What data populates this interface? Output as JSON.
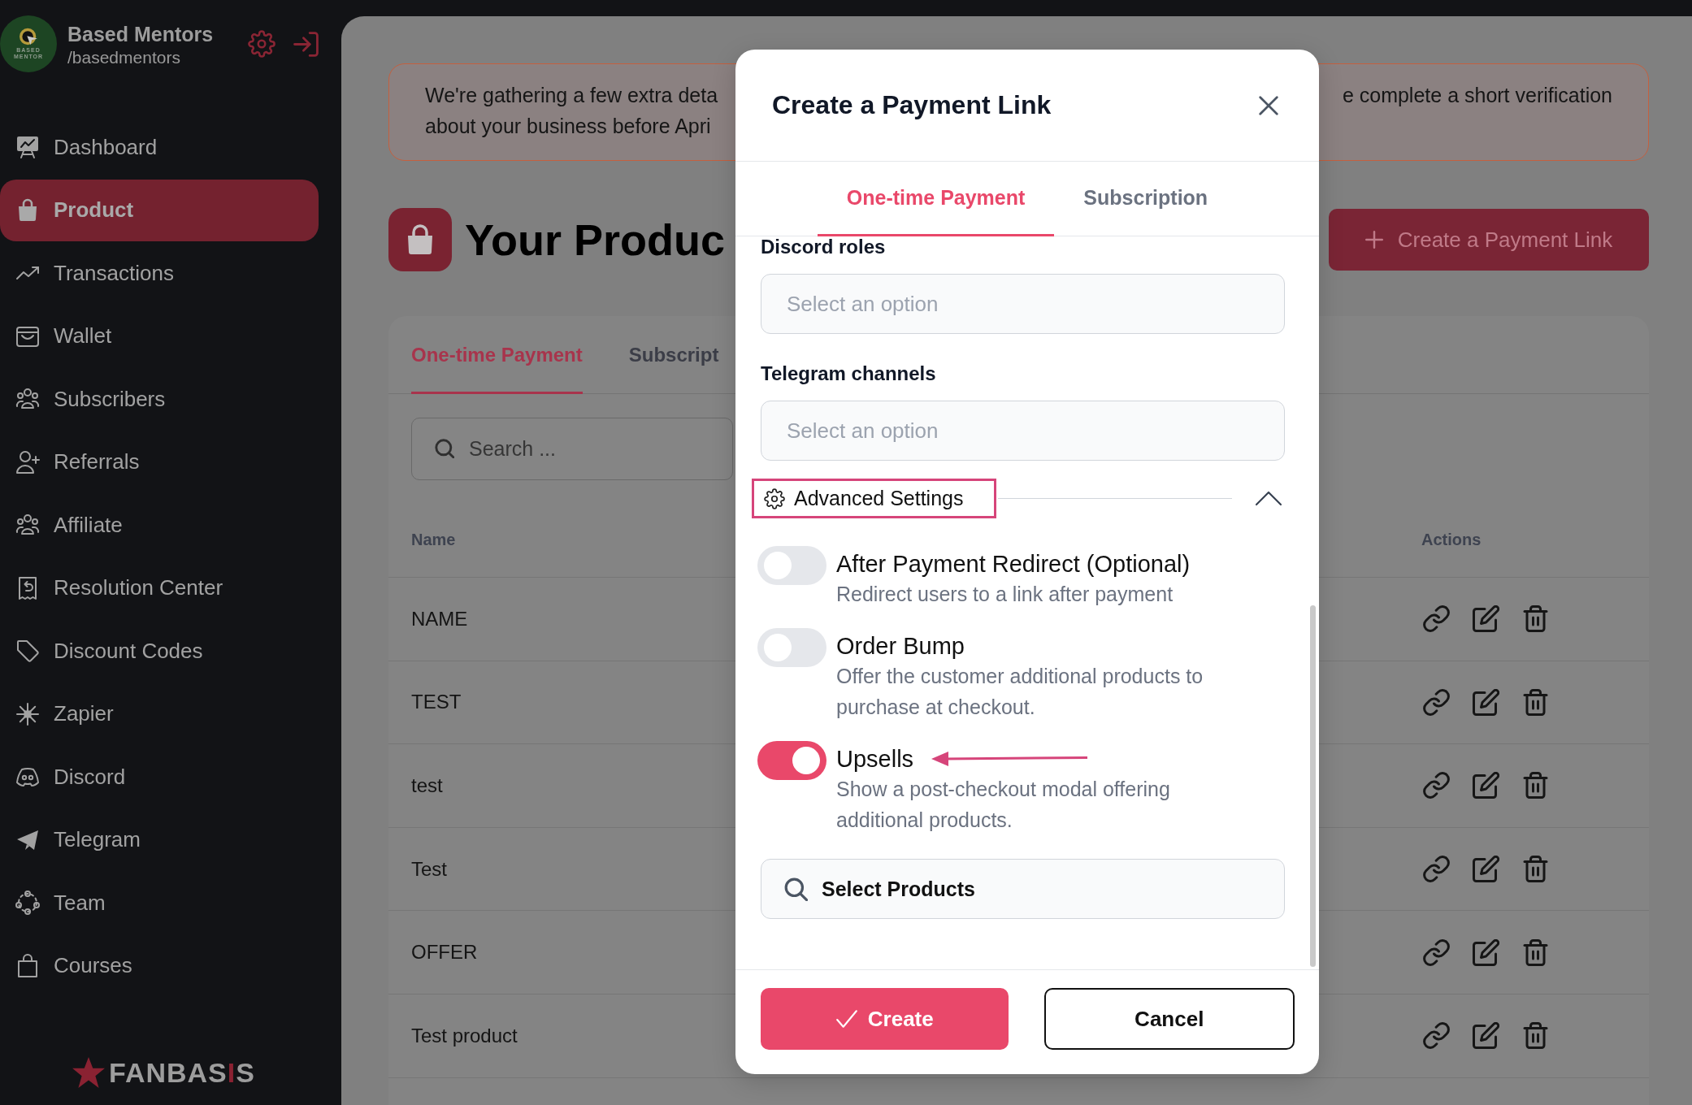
{
  "sidebar": {
    "account": {
      "logo_lines": [
        "BASED",
        "MENTOR"
      ],
      "name": "Based Mentors",
      "handle": "/basedmentors"
    },
    "items": [
      {
        "label": "Dashboard",
        "selected": false
      },
      {
        "label": "Product",
        "selected": true
      },
      {
        "label": "Transactions",
        "selected": false
      },
      {
        "label": "Wallet",
        "selected": false
      },
      {
        "label": "Subscribers",
        "selected": false
      },
      {
        "label": "Referrals",
        "selected": false
      },
      {
        "label": "Affiliate",
        "selected": false
      },
      {
        "label": "Resolution Center",
        "selected": false
      },
      {
        "label": "Discount Codes",
        "selected": false
      },
      {
        "label": "Zapier",
        "selected": false
      },
      {
        "label": "Discord",
        "selected": false
      },
      {
        "label": "Telegram",
        "selected": false
      },
      {
        "label": "Team",
        "selected": false
      },
      {
        "label": "Courses",
        "selected": false
      }
    ],
    "brand": [
      {
        "text": "FANBAS",
        "accent": false
      },
      {
        "text": "I",
        "accent": true
      },
      {
        "text": "S",
        "accent": false
      }
    ]
  },
  "banner": {
    "line_1_left": "We're gathering a few extra deta",
    "line_2_left": "about your business before Apri",
    "line_1_right": "e complete a short verification"
  },
  "page": {
    "title": "Your Produc",
    "create_button": "Create a Payment Link"
  },
  "products": {
    "tabs": [
      {
        "label": "One-time Payment",
        "selected": true
      },
      {
        "label": "Subscript",
        "selected": false
      }
    ],
    "search": {
      "placeholder": "Search ..."
    },
    "columns": [
      "Name",
      "Actions"
    ],
    "rows": [
      {
        "name": "NAME"
      },
      {
        "name": "TEST"
      },
      {
        "name": "test"
      },
      {
        "name": "Test"
      },
      {
        "name": "OFFER"
      },
      {
        "name": "Test product"
      }
    ]
  },
  "modal": {
    "title": "Create a Payment Link",
    "tabs": [
      {
        "label": "One-time Payment",
        "selected": true
      },
      {
        "label": "Subscription",
        "selected": false
      }
    ],
    "fields": [
      {
        "label": "Discord roles",
        "placeholder": "Select an option"
      },
      {
        "label": "Telegram channels",
        "placeholder": "Select an option"
      }
    ],
    "advanced_settings": {
      "label": "Advanced Settings",
      "expanded": true,
      "highlighted": true
    },
    "options": [
      {
        "title": "After Payment Redirect (Optional)",
        "description": "Redirect users to a link after payment",
        "on": false,
        "pointed_at": false
      },
      {
        "title": "Order Bump",
        "description": "Offer the customer additional products to purchase at checkout.",
        "on": false,
        "pointed_at": false
      },
      {
        "title": "Upsells",
        "description": "Show a post-checkout modal offering additional products.",
        "on": true,
        "pointed_at": true
      }
    ],
    "product_picker": {
      "label": "Select Products"
    },
    "buttons": [
      {
        "label": "Create",
        "kind": "primary"
      },
      {
        "label": "Cancel",
        "kind": "secondary"
      }
    ]
  }
}
